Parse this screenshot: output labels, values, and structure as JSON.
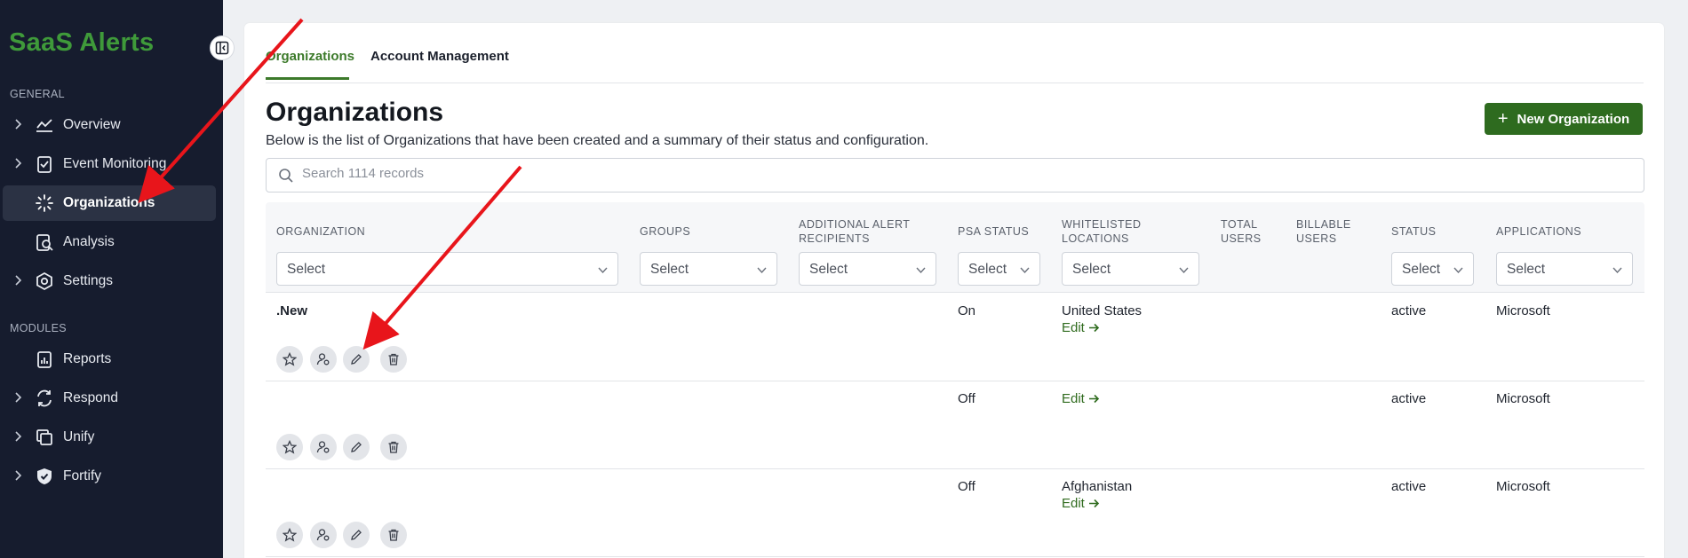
{
  "app": {
    "logo_text": "SaaS Alerts",
    "brand_color": "#3f9a3a",
    "accent_color": "#2e6b1f"
  },
  "sidebar": {
    "sections": [
      {
        "label": "GENERAL"
      },
      {
        "label": "MODULES"
      }
    ],
    "items": [
      {
        "label": "Overview",
        "icon": "trend-line-icon",
        "expandable": true,
        "active": false
      },
      {
        "label": "Event Monitoring",
        "icon": "clipboard-check-icon",
        "expandable": true,
        "active": false
      },
      {
        "label": "Organizations",
        "icon": "sparkle-network-icon",
        "expandable": false,
        "active": true
      },
      {
        "label": "Analysis",
        "icon": "document-search-icon",
        "expandable": false,
        "active": false
      },
      {
        "label": "Settings",
        "icon": "gear-hexagon-icon",
        "expandable": true,
        "active": false
      },
      {
        "label": "Reports",
        "icon": "report-clipboard-icon",
        "expandable": false,
        "active": false
      },
      {
        "label": "Respond",
        "icon": "sync-refresh-icon",
        "expandable": true,
        "active": false
      },
      {
        "label": "Unify",
        "icon": "stacked-windows-icon",
        "expandable": true,
        "active": false
      },
      {
        "label": "Fortify",
        "icon": "shield-check-icon",
        "expandable": true,
        "active": false
      }
    ]
  },
  "tabs": [
    {
      "label": "Organizations",
      "active": true
    },
    {
      "label": "Account Management",
      "active": false
    }
  ],
  "page": {
    "title": "Organizations",
    "description": "Below is the list of Organizations that have been created and a summary of their status and configuration.",
    "new_button": "New Organization"
  },
  "search": {
    "placeholder": "Search 1114 records",
    "value": ""
  },
  "table": {
    "columns": [
      {
        "label": "ORGANIZATION",
        "filter": "Select"
      },
      {
        "label": "GROUPS",
        "filter": "Select"
      },
      {
        "label": "ADDITIONAL ALERT RECIPIENTS",
        "filter": "Select"
      },
      {
        "label": "PSA STATUS",
        "filter": "Select"
      },
      {
        "label": "WHITELISTED LOCATIONS",
        "filter": "Select"
      },
      {
        "label": "TOTAL USERS",
        "filter": null
      },
      {
        "label": "BILLABLE USERS",
        "filter": null
      },
      {
        "label": "STATUS",
        "filter": "Select"
      },
      {
        "label": "APPLICATIONS",
        "filter": "Select"
      }
    ],
    "edit_label": "Edit",
    "rows": [
      {
        "organization": ".New",
        "psa_status": "On",
        "location": "United States",
        "status": "active",
        "applications": "Microsoft"
      },
      {
        "organization": "",
        "psa_status": "Off",
        "location": "",
        "status": "active",
        "applications": "Microsoft"
      },
      {
        "organization": "",
        "psa_status": "Off",
        "location": "Afghanistan",
        "status": "active",
        "applications": "Microsoft"
      }
    ],
    "row_actions": [
      "star-icon",
      "user-settings-icon",
      "pencil-icon",
      "trash-icon"
    ]
  }
}
